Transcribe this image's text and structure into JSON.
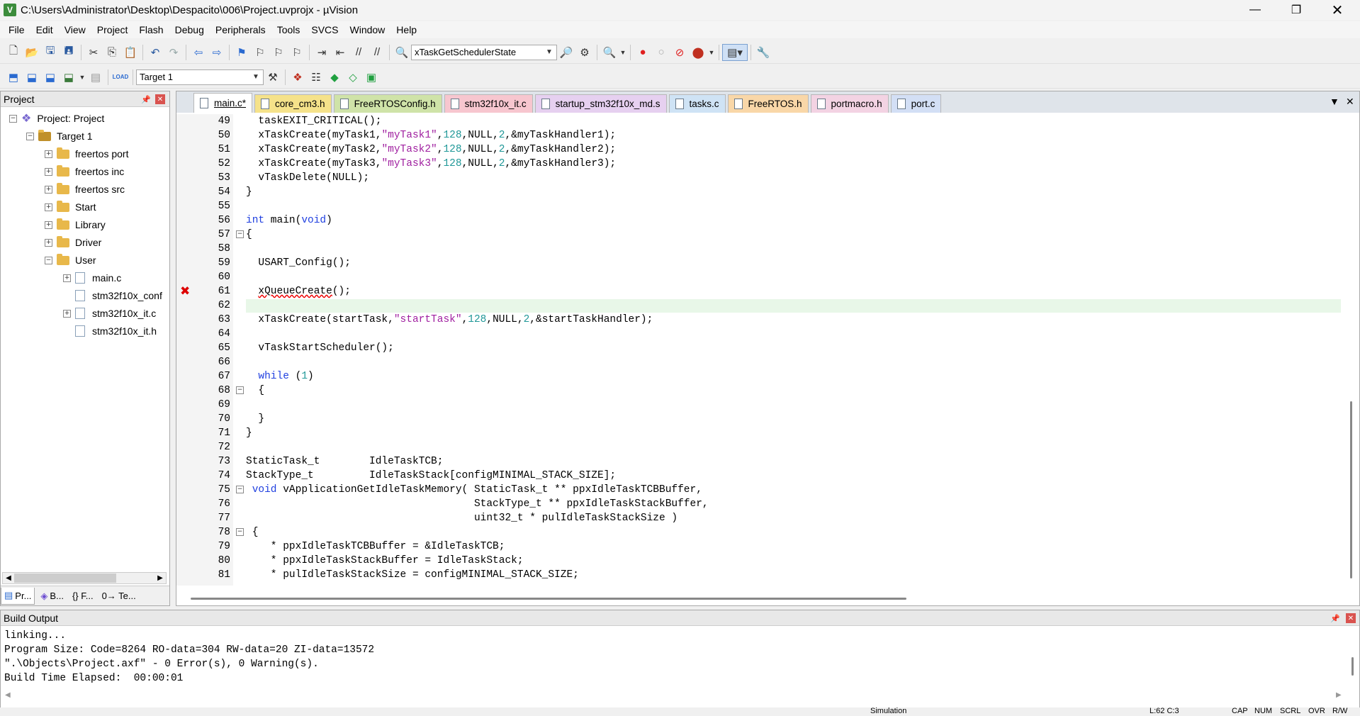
{
  "window": {
    "title": "C:\\Users\\Administrator\\Desktop\\Despacito\\006\\Project.uvprojx - µVision",
    "app_icon_letter": "V"
  },
  "menu": [
    "File",
    "Edit",
    "View",
    "Project",
    "Flash",
    "Debug",
    "Peripherals",
    "Tools",
    "SVCS",
    "Window",
    "Help"
  ],
  "toolbar": {
    "function_combo": "xTaskGetSchedulerState",
    "target_combo": "Target 1",
    "load_label": "LOAD"
  },
  "project_panel": {
    "title": "Project",
    "tree": [
      {
        "label": "Project: Project",
        "level": 0,
        "expander": "−"
      },
      {
        "label": "Target 1",
        "level": 1,
        "expander": "−"
      },
      {
        "label": "freertos port",
        "level": 2,
        "expander": "+",
        "kind": "folder"
      },
      {
        "label": "freertos inc",
        "level": 2,
        "expander": "+",
        "kind": "folder"
      },
      {
        "label": "freertos src",
        "level": 2,
        "expander": "+",
        "kind": "folder"
      },
      {
        "label": "Start",
        "level": 2,
        "expander": "+",
        "kind": "folder"
      },
      {
        "label": "Library",
        "level": 2,
        "expander": "+",
        "kind": "folder"
      },
      {
        "label": "Driver",
        "level": 2,
        "expander": "+",
        "kind": "folder"
      },
      {
        "label": "User",
        "level": 2,
        "expander": "−",
        "kind": "folder"
      },
      {
        "label": "main.c",
        "level": 3,
        "expander": "+",
        "kind": "file"
      },
      {
        "label": "stm32f10x_conf",
        "level": 3,
        "expander": "",
        "kind": "file"
      },
      {
        "label": "stm32f10x_it.c",
        "level": 3,
        "expander": "+",
        "kind": "file"
      },
      {
        "label": "stm32f10x_it.h",
        "level": 3,
        "expander": "",
        "kind": "file"
      }
    ],
    "bottom_tabs": [
      "Pr...",
      "B...",
      "{} F...",
      "0→ Te..."
    ]
  },
  "editor": {
    "tabs": [
      {
        "label": "main.c*",
        "color": "#ffffff",
        "active": true
      },
      {
        "label": "core_cm3.h",
        "color": "#f5e28a"
      },
      {
        "label": "FreeRTOSConfig.h",
        "color": "#cfe3a8"
      },
      {
        "label": "stm32f10x_it.c",
        "color": "#f7c6cf"
      },
      {
        "label": "startup_stm32f10x_md.s",
        "color": "#e6d0f0"
      },
      {
        "label": "tasks.c",
        "color": "#cfe3f5"
      },
      {
        "label": "FreeRTOS.h",
        "color": "#f9d7a8"
      },
      {
        "label": "portmacro.h",
        "color": "#f3d3e3"
      },
      {
        "label": "port.c",
        "color": "#d3dff5"
      }
    ],
    "highlight_line": 62,
    "error_line": 61,
    "lines": [
      {
        "n": "49",
        "code": "  taskEXIT_CRITICAL();"
      },
      {
        "n": "50",
        "code": "  xTaskCreate(myTask1,\"myTask1\",128,NULL,2,&myTaskHandler1);"
      },
      {
        "n": "51",
        "code": "  xTaskCreate(myTask2,\"myTask2\",128,NULL,2,&myTaskHandler2);"
      },
      {
        "n": "52",
        "code": "  xTaskCreate(myTask3,\"myTask3\",128,NULL,2,&myTaskHandler3);"
      },
      {
        "n": "53",
        "code": "  vTaskDelete(NULL);"
      },
      {
        "n": "54",
        "code": "}"
      },
      {
        "n": "55",
        "code": ""
      },
      {
        "n": "56",
        "code": "int main(void)"
      },
      {
        "n": "57",
        "code": "{"
      },
      {
        "n": "58",
        "code": ""
      },
      {
        "n": "59",
        "code": "  USART_Config();"
      },
      {
        "n": "60",
        "code": ""
      },
      {
        "n": "61",
        "code": "  xQueueCreate();"
      },
      {
        "n": "62",
        "code": ""
      },
      {
        "n": "63",
        "code": "  xTaskCreate(startTask,\"startTask\",128,NULL,2,&startTaskHandler);"
      },
      {
        "n": "64",
        "code": ""
      },
      {
        "n": "65",
        "code": "  vTaskStartScheduler();"
      },
      {
        "n": "66",
        "code": ""
      },
      {
        "n": "67",
        "code": "  while (1)"
      },
      {
        "n": "68",
        "code": "  {"
      },
      {
        "n": "69",
        "code": ""
      },
      {
        "n": "70",
        "code": "  }"
      },
      {
        "n": "71",
        "code": "}"
      },
      {
        "n": "72",
        "code": ""
      },
      {
        "n": "73",
        "code": "StaticTask_t        IdleTaskTCB;"
      },
      {
        "n": "74",
        "code": "StackType_t         IdleTaskStack[configMINIMAL_STACK_SIZE];"
      },
      {
        "n": "75",
        "code": " void vApplicationGetIdleTaskMemory( StaticTask_t ** ppxIdleTaskTCBBuffer,"
      },
      {
        "n": "76",
        "code": "                                     StackType_t ** ppxIdleTaskStackBuffer,"
      },
      {
        "n": "77",
        "code": "                                     uint32_t * pulIdleTaskStackSize )"
      },
      {
        "n": "78",
        "code": " {"
      },
      {
        "n": "79",
        "code": "    * ppxIdleTaskTCBBuffer = &IdleTaskTCB;"
      },
      {
        "n": "80",
        "code": "    * ppxIdleTaskStackBuffer = IdleTaskStack;"
      },
      {
        "n": "81",
        "code": "    * pulIdleTaskStackSize = configMINIMAL_STACK_SIZE;"
      }
    ]
  },
  "build_output": {
    "title": "Build Output",
    "lines": [
      "linking...",
      "Program Size: Code=8264 RO-data=304 RW-data=20 ZI-data=13572",
      "\".\\Objects\\Project.axf\" - 0 Error(s), 0 Warning(s).",
      "Build Time Elapsed:  00:00:01"
    ]
  },
  "status": {
    "mode": "Simulation",
    "cursor": "L:62 C:3",
    "keys": [
      "CAP",
      "NUM",
      "SCRL",
      "OVR",
      "R/W"
    ]
  },
  "colors": {
    "keyword": "#2040e0",
    "string": "#a020a0",
    "number": "#209898",
    "highlight": "#e8f7e8",
    "error": "#dd0000"
  }
}
